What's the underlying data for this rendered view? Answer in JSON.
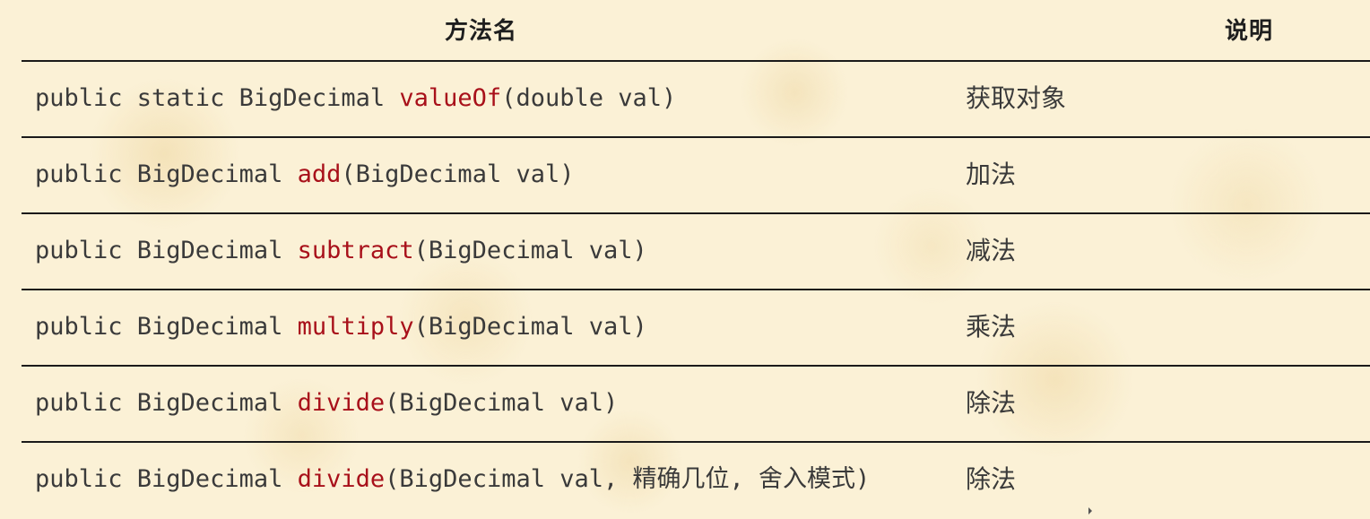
{
  "table": {
    "headers": {
      "method": "方法名",
      "description": "说明"
    },
    "rows": [
      {
        "prefix": "public static BigDecimal ",
        "method": "valueOf",
        "params": "(double val)",
        "description": "获取对象"
      },
      {
        "prefix": "public BigDecimal ",
        "method": "add",
        "params": "(BigDecimal val)",
        "description": "加法"
      },
      {
        "prefix": "public BigDecimal ",
        "method": "subtract",
        "params": "(BigDecimal val)",
        "description": "减法"
      },
      {
        "prefix": "public BigDecimal ",
        "method": "multiply",
        "params": "(BigDecimal val)",
        "description": "乘法"
      },
      {
        "prefix": "public BigDecimal ",
        "method": "divide",
        "params": "(BigDecimal val)",
        "description": "除法"
      },
      {
        "prefix": "public BigDecimal ",
        "method": "divide",
        "params": "(BigDecimal val, 精确几位, 舍入模式)",
        "description": "除法"
      }
    ]
  },
  "colors": {
    "method_name": "#a8101a",
    "text": "#3a3a3a",
    "background": "#fbf1d6",
    "rule": "#1a1a1a"
  }
}
